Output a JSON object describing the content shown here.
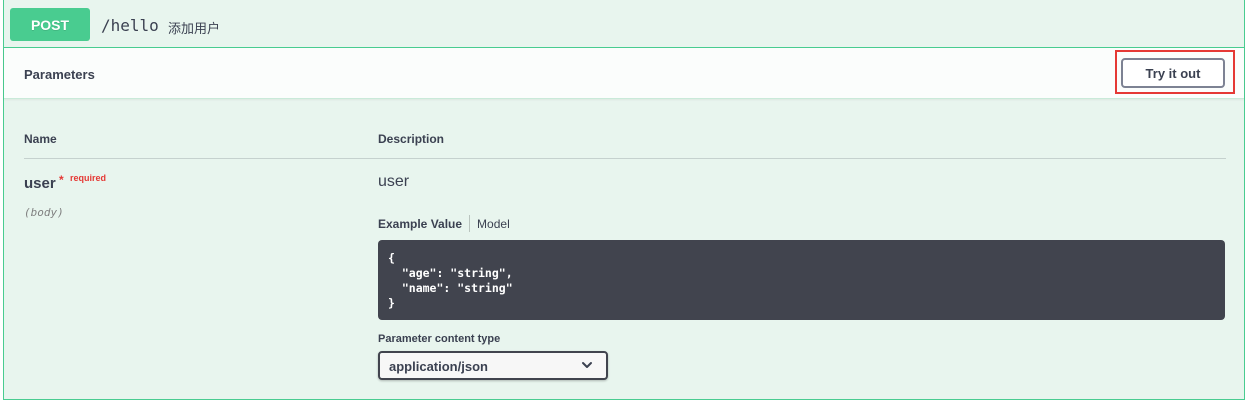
{
  "summary": {
    "method": "POST",
    "path": "/hello",
    "description": "添加用户"
  },
  "parameters_header": {
    "title": "Parameters",
    "try_it_out_label": "Try it out"
  },
  "table": {
    "headers": [
      "Name",
      "Description"
    ]
  },
  "param": {
    "name": "user",
    "required_star": "*",
    "required_text": "required",
    "in": "(body)",
    "description": "user"
  },
  "example": {
    "tabs": [
      "Example Value",
      "Model"
    ],
    "code": "{\n  \"age\": \"string\",\n  \"name\": \"string\"\n}"
  },
  "content_type": {
    "label": "Parameter content type",
    "selected": "application/json"
  },
  "icons": {
    "select_chevron": "chevron-down-icon"
  },
  "colors": {
    "method_post": "#49cc90",
    "highlight_box": "#e53935",
    "code_bg": "#41444e"
  }
}
